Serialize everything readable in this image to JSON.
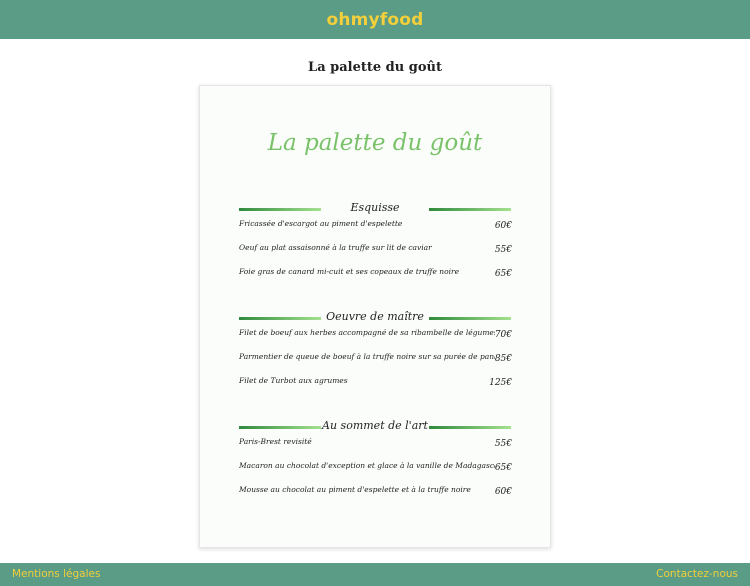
{
  "header": {
    "brand": "ohmyfood"
  },
  "page_title": "La palette du goût",
  "card": {
    "title": "La palette du goût",
    "sections": [
      {
        "title": "Esquisse",
        "items": [
          {
            "name": "Fricassée d'escargot au piment d'espelette",
            "price": "60€"
          },
          {
            "name": "Oeuf au plat assaisonné à la truffe sur lit de caviar",
            "price": "55€"
          },
          {
            "name": "Foie gras de canard mi-cuit et ses copeaux de truffe noire",
            "price": "65€"
          }
        ]
      },
      {
        "title": "Oeuvre de maître",
        "items": [
          {
            "name": "Filet de boeuf aux herbes accompagné de sa ribambelle de légumes",
            "price": "70€"
          },
          {
            "name": "Parmentier de queue de boeuf à la truffe noire sur sa purée de panais",
            "price": "85€"
          },
          {
            "name": "Filet de Turbot aux agrumes",
            "price": "125€"
          }
        ]
      },
      {
        "title": "Au sommet de l'art",
        "items": [
          {
            "name": "Paris-Brest revisité",
            "price": "55€"
          },
          {
            "name": "Macaron au chocolat d'exception et glace à la vanille de Madagascar",
            "price": "65€"
          },
          {
            "name": "Mousse au chocolat au piment d'espelette et à la truffe noire",
            "price": "60€"
          }
        ]
      }
    ]
  },
  "footer": {
    "legal": "Mentions légales",
    "contact": "Contactez-nous"
  },
  "colors": {
    "bar": "#5a9c85",
    "brand": "#f2cf3b",
    "title_green": "#79c26a"
  }
}
